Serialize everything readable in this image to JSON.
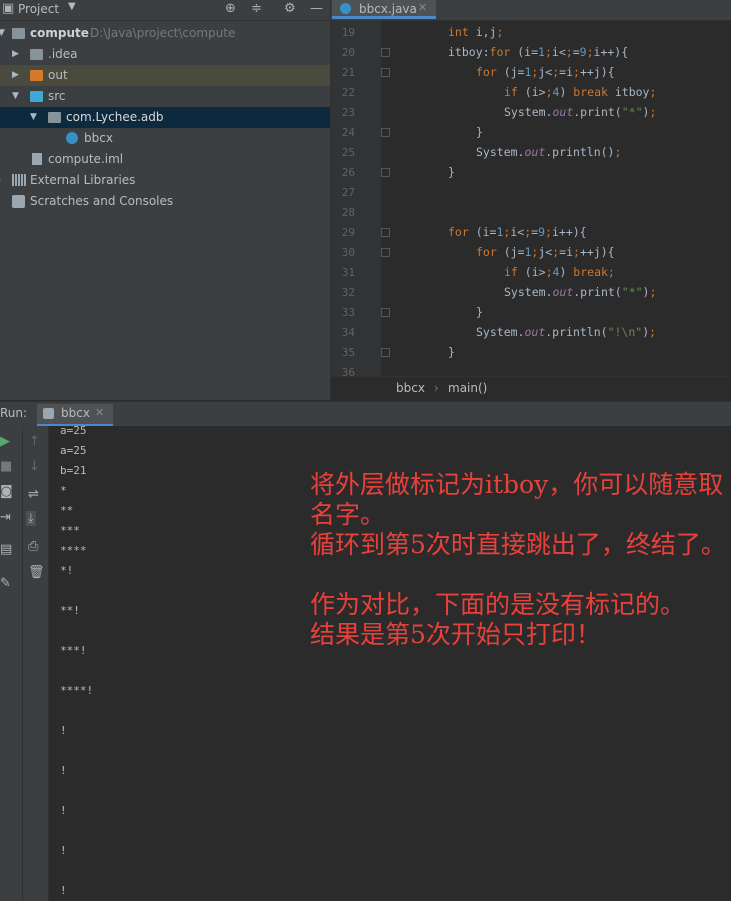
{
  "project": {
    "header_title": "Project",
    "tree": [
      {
        "label": "compute",
        "path": "D:\\Java\\project\\compute"
      },
      {
        "label": ".idea"
      },
      {
        "label": "out"
      },
      {
        "label": "src"
      },
      {
        "label": "com.Lychee.adb"
      },
      {
        "label": "bbcx"
      },
      {
        "label": "compute.iml"
      },
      {
        "label": "External Libraries"
      },
      {
        "label": "Scratches and Consoles"
      }
    ]
  },
  "editor": {
    "tab": "bbcx.java",
    "line_numbers": [
      "19",
      "20",
      "21",
      "22",
      "23",
      "24",
      "25",
      "26",
      "27",
      "28",
      "29",
      "30",
      "31",
      "32",
      "33",
      "34",
      "35",
      "36"
    ],
    "breadcrumb": [
      "bbcx",
      "main()"
    ],
    "lines": {
      "l19": "int i,j;",
      "l20": "itboy:for (i=1;i<=9;i++){",
      "l21": "for (j=1;j<=i;++j){",
      "l22": "if (i>4) break itboy;",
      "l23": "System.out.print(\"*\");",
      "l24": "}",
      "l25": "System.out.println();",
      "l26": "}",
      "l29": "for (i=1;i<=9;i++){",
      "l30": "for (j=1;j<=i;++j){",
      "l31": "if (i>4) break;",
      "l32": "System.out.print(\"*\");",
      "l33": "}",
      "l34": "System.out.println(\"!\\n\");",
      "l35": "}"
    }
  },
  "run": {
    "label": "Run:",
    "tab": "bbcx",
    "output": [
      "a=25",
      "a=25",
      "b=21",
      "*",
      "**",
      "***",
      "****",
      "*!",
      "**!",
      "***!",
      "****!",
      "!",
      "!",
      "!",
      "!",
      "!"
    ]
  },
  "annotation": {
    "p1": "将外层做标记为itboy，你可以随意取名字。",
    "p2": "循环到第5次时直接跳出了，终结了。",
    "p3": "作为对比，下面的是没有标记的。",
    "p4": "结果是第5次开始只打印！"
  },
  "colors": {
    "keyword": "#cc7832",
    "number": "#6897bb",
    "string": "#6a8759",
    "annotation": "#e8413b",
    "selection": "#0d293e"
  }
}
